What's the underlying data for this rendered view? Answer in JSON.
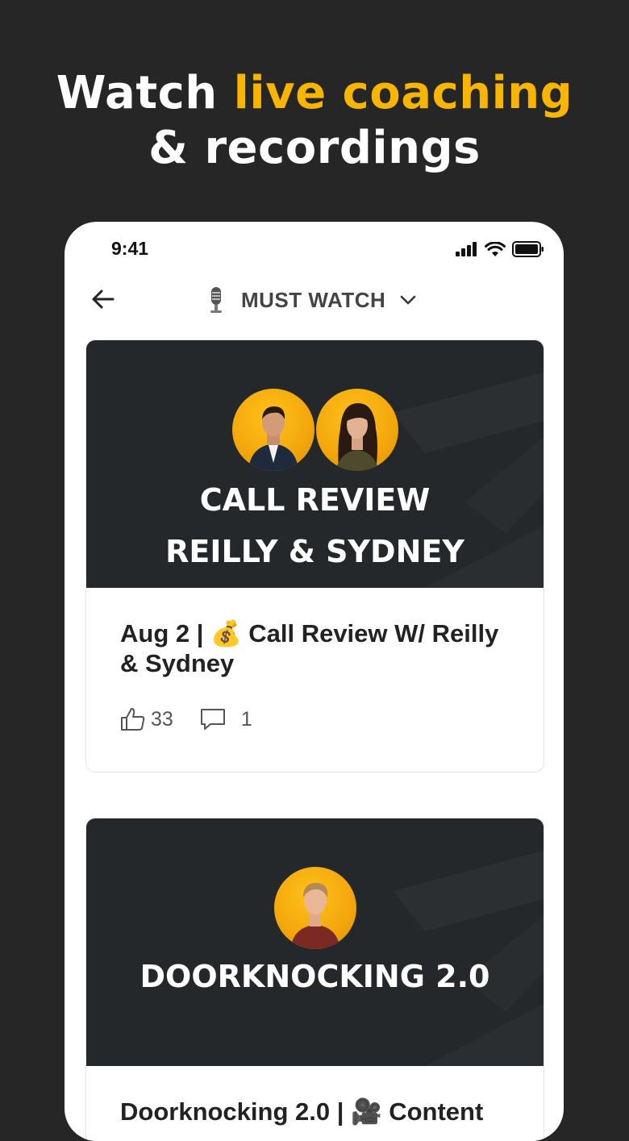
{
  "headline": {
    "line1_plain": "Watch ",
    "line1_accent": "live coaching",
    "line2": "& recordings"
  },
  "colors": {
    "accent": "#f7b500",
    "background": "#262626",
    "card_dark": "#25282b"
  },
  "status_bar": {
    "time": "9:41"
  },
  "navbar": {
    "title": "MUST WATCH",
    "icon": "microphone-icon"
  },
  "posts": [
    {
      "thumbnail_title_line1": "CALL REVIEW",
      "thumbnail_title_line2": "REILLY & SYDNEY",
      "title": "Aug 2 | 💰 Call Review W/ Reilly & Sydney",
      "likes": "33",
      "comments": "1"
    },
    {
      "thumbnail_title_line1": "DOORKNOCKING 2.0",
      "title": "Doorknocking 2.0 | 🎥 Content"
    }
  ]
}
